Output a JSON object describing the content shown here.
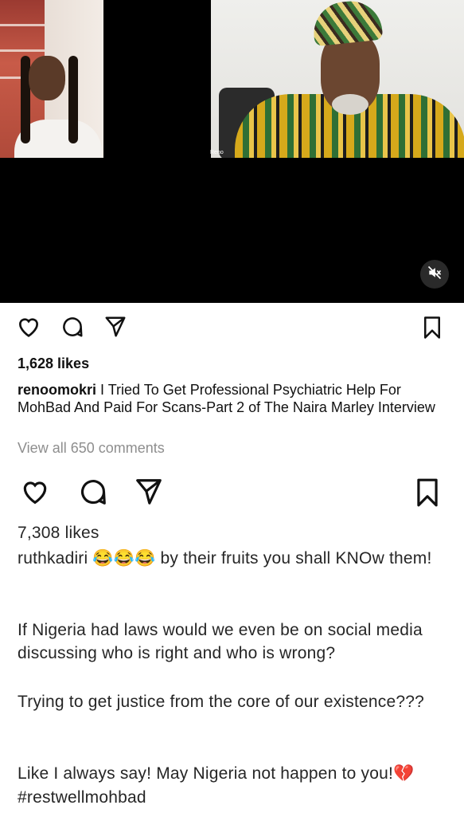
{
  "video": {
    "right_name_tag": "Reno"
  },
  "post1": {
    "likes": "1,628 likes",
    "username": "renoomokri",
    "caption": "I Tried To Get Professional Psychiatric Help For MohBad And Paid For Scans-Part 2 of The Naira Marley Interview",
    "view_comments": "View all 650 comments"
  },
  "post2": {
    "likes": "7,308 likes",
    "username": "ruthkadiri",
    "emojis": "😂😂😂",
    "line1_rest": " by their fruits you shall KNOw them!",
    "para2": "If Nigeria had laws would we even be on social media discussing who is right and who is wrong?",
    "para3": "Trying to get justice from the  core of our existence???",
    "para4": "Like I always say! May Nigeria not happen to you!",
    "para4_emoji": "💔",
    "hashtag": "#restwellmohbad"
  },
  "icons": [
    "heart-icon",
    "comment-icon",
    "share-icon",
    "bookmark-icon",
    "muted-speaker-icon"
  ],
  "colors": {
    "hashtag": "#22445f",
    "muted": "#8e8e8e"
  }
}
